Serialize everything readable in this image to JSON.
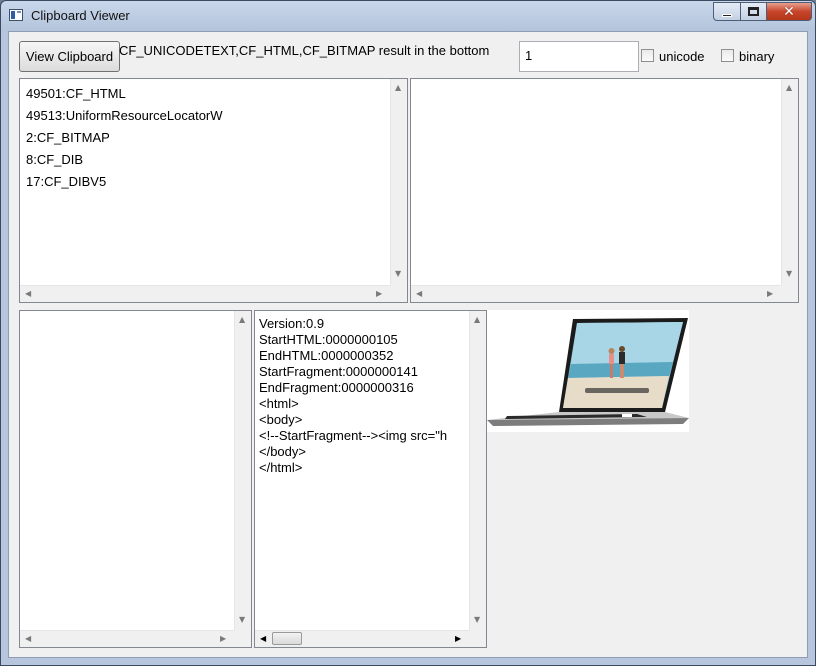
{
  "window": {
    "title": "Clipboard Viewer",
    "close_glyph": "✕"
  },
  "toolbar": {
    "view_button_label": "View Clipboard",
    "hint_text": "CF_UNICODETEXT,CF_HTML,CF_BITMAP result in the bottom",
    "index_value": "1",
    "unicode_label": "unicode",
    "unicode_checked": false,
    "binary_label": "binary",
    "binary_checked": false
  },
  "formats_list": {
    "items": [
      "49501:CF_HTML",
      "49513:UniformResourceLocatorW",
      "2:CF_BITMAP",
      "8:CF_DIB",
      "17:CF_DIBV5"
    ]
  },
  "raw_data_pane": {
    "text": ""
  },
  "unicode_text_pane": {
    "text": ""
  },
  "html_pane": {
    "lines": [
      "Version:0.9",
      "StartHTML:0000000105",
      "EndHTML:0000000352",
      "StartFragment:0000000141",
      "EndFragment:0000000316",
      "<html>",
      "<body>",
      "<!--StartFragment--><img src=\"h",
      "</body>",
      "</html>"
    ]
  },
  "bitmap_preview": {
    "icon": "laptop-image"
  },
  "scroll_glyphs": {
    "up": "▲",
    "down": "▼",
    "left": "◀",
    "right": "▶"
  },
  "colors": {
    "titlebar": "#b7c6dc",
    "client_bg": "#f0f0f0",
    "close_button": "#c7452a"
  }
}
